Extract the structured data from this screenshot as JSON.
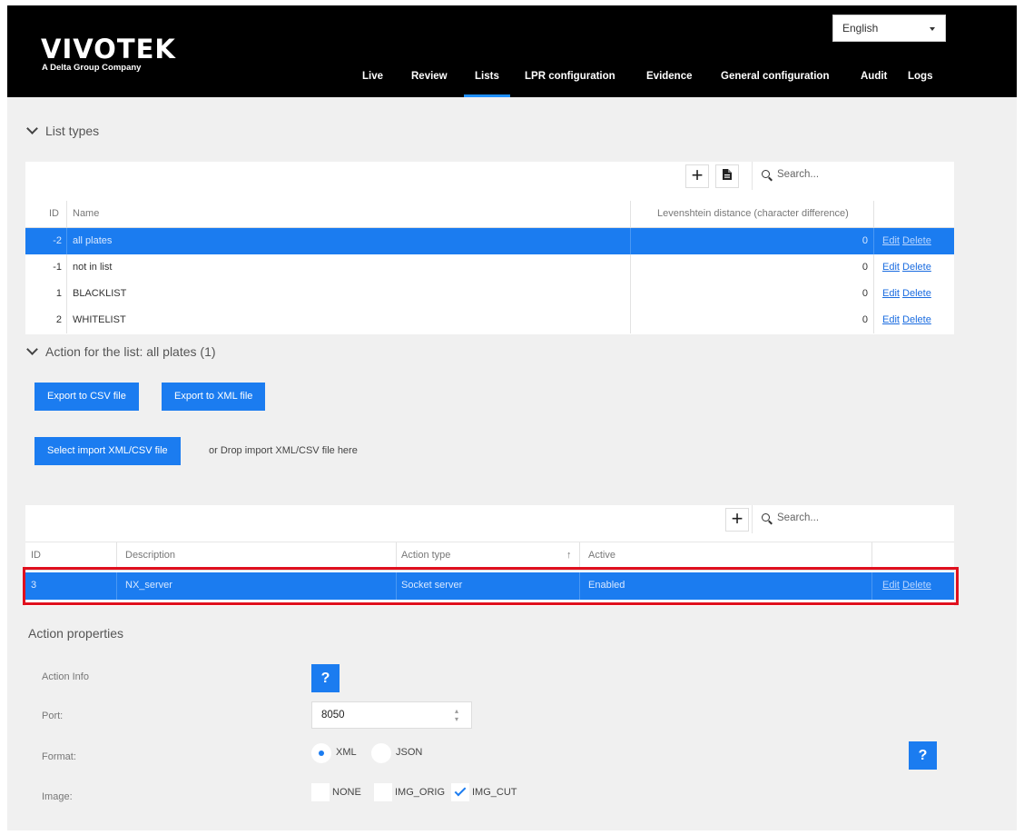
{
  "header": {
    "logo_text": "VIVOTEK",
    "logo_subtitle": "A Delta Group Company",
    "language": "English",
    "nav": [
      "Live",
      "Review",
      "Lists",
      "LPR configuration",
      "Evidence",
      "General configuration",
      "Audit",
      "Logs"
    ],
    "active_nav": "Lists"
  },
  "list_types": {
    "title": "List types",
    "search_placeholder": "Search...",
    "columns": [
      "ID",
      "Name",
      "Levenshtein distance (character difference)"
    ],
    "rows": [
      {
        "id": "-2",
        "name": "all plates",
        "distance": "0",
        "edit": "Edit",
        "delete": "Delete"
      },
      {
        "id": "-1",
        "name": "not in list",
        "distance": "0",
        "edit": "Edit",
        "delete": "Delete"
      },
      {
        "id": "1",
        "name": "BLACKLIST",
        "distance": "0",
        "edit": "Edit",
        "delete": "Delete"
      },
      {
        "id": "2",
        "name": "WHITELIST",
        "distance": "0",
        "edit": "Edit",
        "delete": "Delete"
      }
    ]
  },
  "actions": {
    "title": "Action for the list: all plates (1)",
    "export_csv": "Export to CSV file",
    "export_xml": "Export to XML file",
    "select_import": "Select import XML/CSV file",
    "drop_text": "or Drop import XML/CSV file here",
    "search_placeholder": "Search...",
    "columns": [
      "ID",
      "Description",
      "Action type",
      "Active"
    ],
    "sort_indicator": "↑",
    "rows": [
      {
        "id": "3",
        "description": "NX_server",
        "type": "Socket server",
        "active": "Enabled",
        "edit": "Edit",
        "delete": "Delete"
      }
    ]
  },
  "properties": {
    "title": "Action properties",
    "action_info_label": "Action Info",
    "help": "?",
    "port_label": "Port:",
    "port_value": "8050",
    "format_label": "Format:",
    "format_options": [
      "XML",
      "JSON"
    ],
    "format_selected": "XML",
    "image_label": "Image:",
    "image_options": [
      "NONE",
      "IMG_ORIG",
      "IMG_CUT"
    ],
    "image_checked": [
      "IMG_CUT"
    ]
  },
  "colors": {
    "accent": "#1b7cf0",
    "highlight_border": "#e0101e",
    "header_bg": "#000000"
  }
}
